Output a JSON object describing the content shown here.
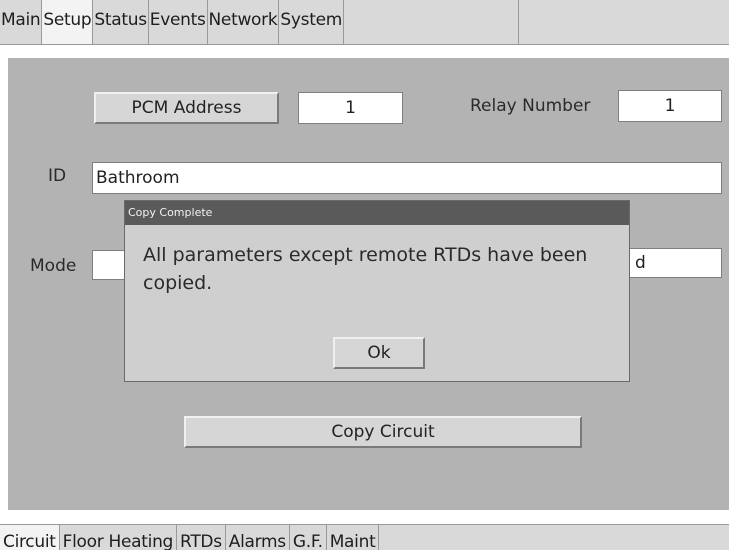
{
  "top_tabs": [
    {
      "label": "Main"
    },
    {
      "label": "Setup",
      "active": true
    },
    {
      "label": "Status"
    },
    {
      "label": "Events"
    },
    {
      "label": "Network"
    },
    {
      "label": "System"
    }
  ],
  "setup": {
    "pcm_address_button": "PCM Address",
    "pcm_address_value": "1",
    "relay_number_label": "Relay Number",
    "relay_number_value": "1",
    "id_label": "ID",
    "id_value": "Bathroom",
    "mode_label": "Mode",
    "mode_value_partial": "d",
    "copy_circuit_button": "Copy Circuit"
  },
  "dialog": {
    "title": "Copy Complete",
    "message": "All parameters except remote RTDs have been copied.",
    "ok_button": "Ok"
  },
  "bottom_tabs": [
    {
      "label": "Circuit",
      "active": true
    },
    {
      "label": "Floor Heating"
    },
    {
      "label": "RTDs"
    },
    {
      "label": "Alarms"
    },
    {
      "label": "G.F."
    },
    {
      "label": "Maint"
    }
  ],
  "colors": {
    "panel_background": "#b3b3b3",
    "tab_background": "#d9d9d9",
    "active_tab_background": "#f3f3f3",
    "dialog_title_bar": "#5a5a5a",
    "dialog_background": "#cfcfcf"
  }
}
